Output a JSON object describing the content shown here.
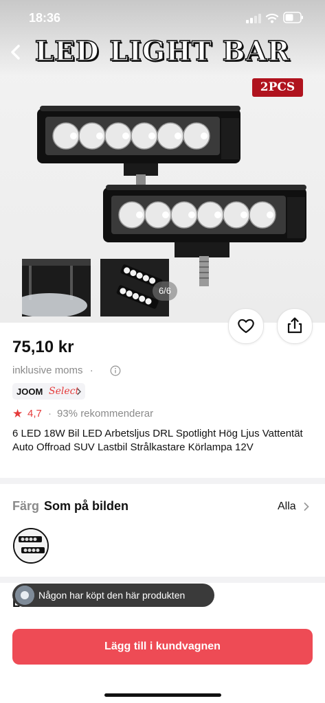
{
  "status_bar": {
    "time": "18:36"
  },
  "gallery": {
    "banner_title": "LED LIGHT BAR",
    "banner_badge": "2PCS",
    "counter": "6/6"
  },
  "product": {
    "price": "75,10 kr",
    "tax_note": "inklusive moms",
    "joom_select": {
      "brand": "JOOM",
      "label": "Select"
    },
    "rating": "4,7",
    "rating_separator": "·",
    "recommend_text": "93% rekommenderar",
    "title": "6 LED 18W Bil LED Arbetsljus DRL Spotlight Hög Ljus Vattentät Auto Offroad SUV Lastbil Strålkastare Körlampa 12V"
  },
  "color_section": {
    "label": "Färg",
    "value": "Som på bilden",
    "all_link": "Alla"
  },
  "delivery": {
    "title": "Leverans"
  },
  "toast": {
    "text": "Någon har köpt den här produkten"
  },
  "cart_button": {
    "label": "Lägg till i kundvagnen"
  },
  "icons": {
    "back": "chevron-left-icon",
    "favorite": "heart-icon",
    "share": "share-icon",
    "info": "info-icon",
    "rating": "star-icon",
    "more": "chevron-right-icon"
  },
  "colors": {
    "accent": "#ee4b55",
    "rating": "#e53b3b",
    "badge": "#b0131e"
  }
}
